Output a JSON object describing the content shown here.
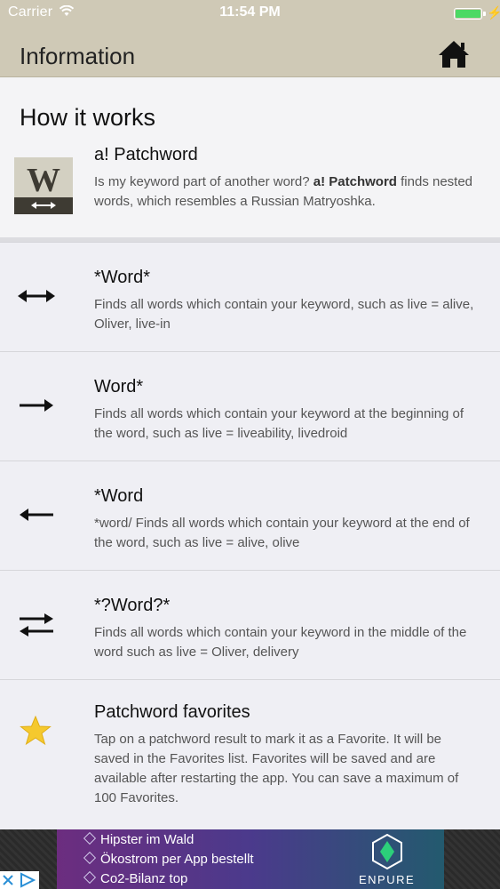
{
  "status": {
    "carrier": "Carrier",
    "time": "11:54 PM"
  },
  "navbar": {
    "title": "Information"
  },
  "intro": {
    "heading": "How it works",
    "app_name": "a! Patchword",
    "logo_letter": "W",
    "desc_1": "Is my keyword part of another word? ",
    "desc_bold": "a! Patchword",
    "desc_2": " finds nested words, which resembles a Russian Matryoshka."
  },
  "rows": [
    {
      "title": "*Word*",
      "desc": "Finds all words which contain your keyword, such as live = alive, Oliver, live-in",
      "icon": "double-arrow-icon"
    },
    {
      "title": "Word*",
      "desc": "Finds all words which contain your keyword at the beginning of the word, such as live = liveability, livedroid",
      "icon": "arrow-right-icon"
    },
    {
      "title": "*Word",
      "desc": "*word/ Finds all words which contain your keyword at the end of the word, such as live = alive, olive",
      "icon": "arrow-left-icon"
    },
    {
      "title": "*?Word?*",
      "desc": "Finds all words which contain your keyword in the middle of the word such as live = Oliver, delivery",
      "icon": "swap-arrows-icon"
    },
    {
      "title": "Patchword favorites",
      "desc": "Tap on a patchword result to mark it as a Favorite. It will be saved in the Favorites list. Favorites will be saved and are available after restarting the app. You can save a maximum of 100 Favorites.",
      "icon": "star-icon"
    }
  ],
  "ad": {
    "line_1": "Hipster im Wald",
    "line_2": "Ökostrom per App bestellt",
    "line_3": "Co2-Bilanz top",
    "brand": "ENPURE"
  },
  "colors": {
    "navbar": "#cfc9b6",
    "background": "#efeff4",
    "star": "#f5c92e",
    "battery": "#4cd964"
  }
}
